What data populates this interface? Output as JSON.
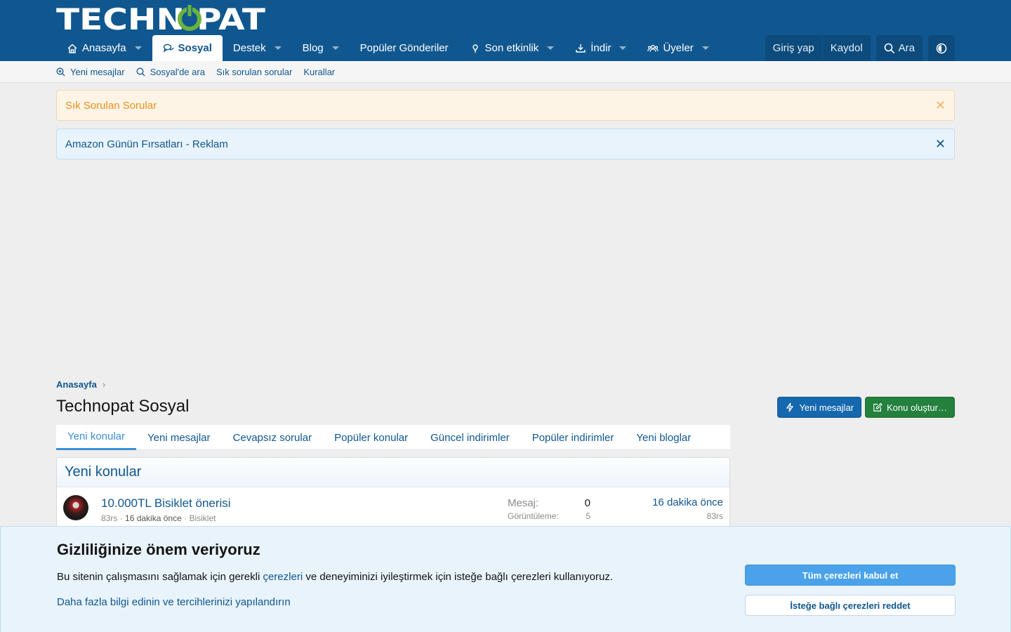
{
  "logo": {
    "text": "TECHNOPAT"
  },
  "nav": {
    "items": [
      {
        "label": "Anasayfa",
        "icon": "home-icon",
        "caret": true,
        "active": false
      },
      {
        "label": "Sosyal",
        "icon": "chat-icon",
        "caret": false,
        "active": true
      },
      {
        "label": "Destek",
        "icon": "",
        "caret": true,
        "active": false
      },
      {
        "label": "Blog",
        "icon": "",
        "caret": true,
        "active": false
      },
      {
        "label": "Popüler Gönderiler",
        "icon": "",
        "caret": false,
        "active": false
      },
      {
        "label": "Son etkinlik",
        "icon": "bulb-icon",
        "caret": true,
        "active": false
      },
      {
        "label": "İndir",
        "icon": "download-icon",
        "caret": true,
        "active": false
      },
      {
        "label": "Üyeler",
        "icon": "users-icon",
        "caret": true,
        "active": false
      }
    ],
    "login": "Giriş yap",
    "register": "Kaydol",
    "search": "Ara"
  },
  "subnav": {
    "items": [
      {
        "label": "Yeni mesajlar",
        "icon": "zoom-icon"
      },
      {
        "label": "Sosyal'de ara",
        "icon": "search-icon"
      },
      {
        "label": "Sık sorulan sorular",
        "icon": ""
      },
      {
        "label": "Kurallar",
        "icon": ""
      }
    ]
  },
  "notices": {
    "faq": "Sık Sorulan Sorular",
    "amazon": "Amazon Günün Fırsatları - Reklam",
    "close_glyph": "✕"
  },
  "breadcrumb": {
    "home": "Anasayfa",
    "separator": "›"
  },
  "page": {
    "title": "Technopat Sosyal",
    "new_messages_btn": "Yeni mesajlar",
    "create_thread_btn": "Konu oluştur…"
  },
  "tabs": {
    "items": [
      "Yeni konular",
      "Yeni mesajlar",
      "Cevapsız sorular",
      "Popüler konular",
      "Güncel indirimler",
      "Popüler indirimler",
      "Yeni bloglar"
    ],
    "active_index": 0
  },
  "latest": {
    "title": "Yeni konular",
    "threads": [
      {
        "title": "10.000TL Bisiklet önerisi",
        "author": "83rs",
        "time": "16 dakika önce",
        "forum": "Bisiklet",
        "replies_label": "Mesaj:",
        "replies": "0",
        "views_label": "Görüntüleme:",
        "views": "5",
        "last_time": "16 dakika önce",
        "last_user": "83rs"
      }
    ]
  },
  "cookie": {
    "title": "Gizliliğinize önem veriyoruz",
    "text_before": "Bu sitenin çalışmasını sağlamak için gerekli ",
    "text_link": "çerezleri",
    "text_after": " ve deneyiminizi iyileştirmek için isteğe bağlı çerezleri kullanıyoruz.",
    "more": "Daha fazla bilgi edinin ve tercihlerinizi yapılandırın",
    "accept": "Tüm çerezleri kabul et",
    "reject": "İsteğe bağlı çerezleri reddet"
  },
  "colors": {
    "header": "#11578f",
    "link": "#11578f",
    "accent_blue": "#1568ae",
    "accent_green": "#23813d",
    "power_green": "#6ab43e"
  }
}
